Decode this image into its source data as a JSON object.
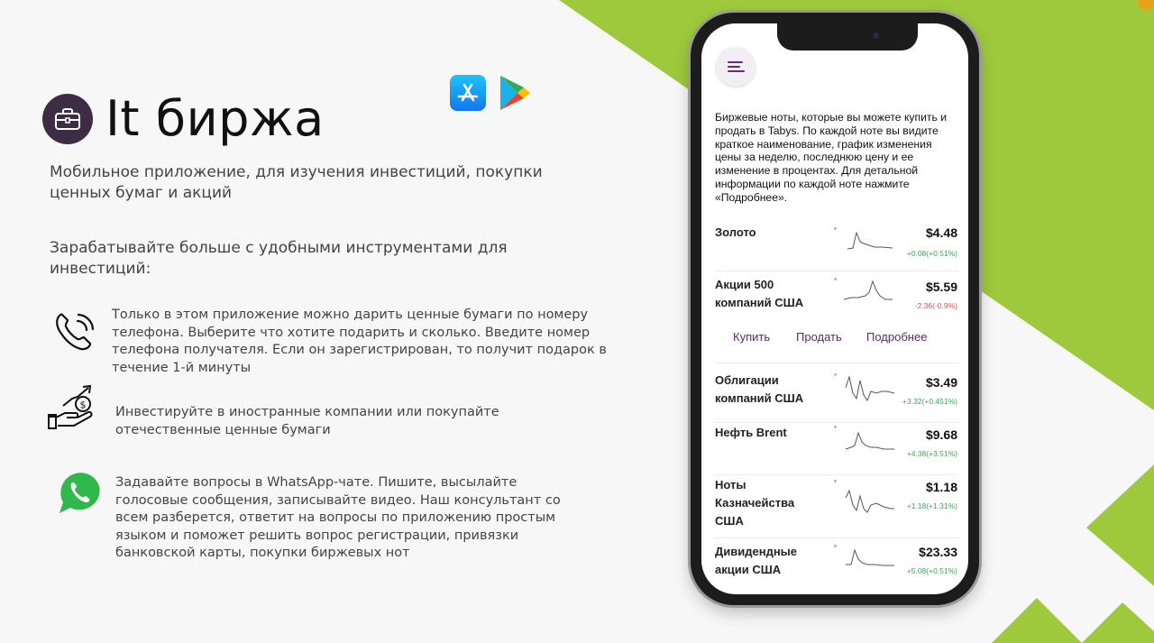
{
  "brand": {
    "title": "It биржа",
    "icon": "briefcase-icon"
  },
  "stores": [
    {
      "icon": "app-store-icon"
    },
    {
      "icon": "google-play-icon"
    }
  ],
  "subtitle": "Мобильное приложение, для изучения инвестиций, покупки ценных бумаг и акций",
  "earn_heading": "Зарабатывайте больше с удобными инструментами для инвестиций:",
  "features": [
    {
      "icon": "phone-call-icon",
      "text": "Только в этом приложение можно дарить ценные бумаги по номеру телефона. Выберите что хотите подарить и сколько. Введите номер телефона получателя. Если он зарегистрирован, то получит подарок в течение 1-й минуты"
    },
    {
      "icon": "hand-coin-growth-icon",
      "text": "Инвестируйте в иностранные компании или покупайте отечественные ценные бумаги"
    },
    {
      "icon": "whatsapp-icon",
      "text": "Задавайте вопросы в WhatsApp-чате. Пишите, высылайте голосовые сообщения, записывайте видео. Наш консультант со всем разберется, ответит на вопросы по приложению простым языком и поможет решить вопрос регистрации, привязки банковской карты, покупки биржевых нот"
    }
  ],
  "phone": {
    "intro": "Биржевые ноты, которые вы можете купить и продать в Tabys. По каждой ноте вы видите краткое наименование, график изменения цены за неделю, последнюю цену и ее изменение в процентах. Для детальной информации по каждой ноте нажмите «Подробнее».",
    "notes": [
      {
        "name": "Золото",
        "price": "$4.48",
        "change": "+0.08(+0.51%)",
        "direction": "up",
        "chevron": "˅"
      },
      {
        "name": "Акции 500 компаний США",
        "price": "$5.59",
        "change": "-2.36(-0.9%)",
        "direction": "down",
        "chevron": "˄"
      },
      {
        "name": "Облигации компаний США",
        "price": "$3.49",
        "change": "+3.32(+0.451%)",
        "direction": "up",
        "chevron": "˅"
      },
      {
        "name": "Нефть Brent",
        "price": "$9.68",
        "change": "+4.38(+3.51%)",
        "direction": "up",
        "chevron": "˅"
      },
      {
        "name": "Ноты Казначейства США",
        "price": "$1.18",
        "change": "+1.18(+1.31%)",
        "direction": "up",
        "chevron": "˅"
      },
      {
        "name": "Дивидендные акции США",
        "price": "$23.33",
        "change": "+5.08(+0.51%)",
        "direction": "up",
        "chevron": "˅"
      }
    ],
    "actions": {
      "buy": "Купить",
      "sell": "Продать",
      "details": "Подробнее"
    }
  },
  "colors": {
    "accent_green": "#9ec93c",
    "brand_purple": "#3c2c44",
    "action_purple": "#5a2a6a",
    "positive": "#3aa55a",
    "negative": "#d9534f"
  }
}
